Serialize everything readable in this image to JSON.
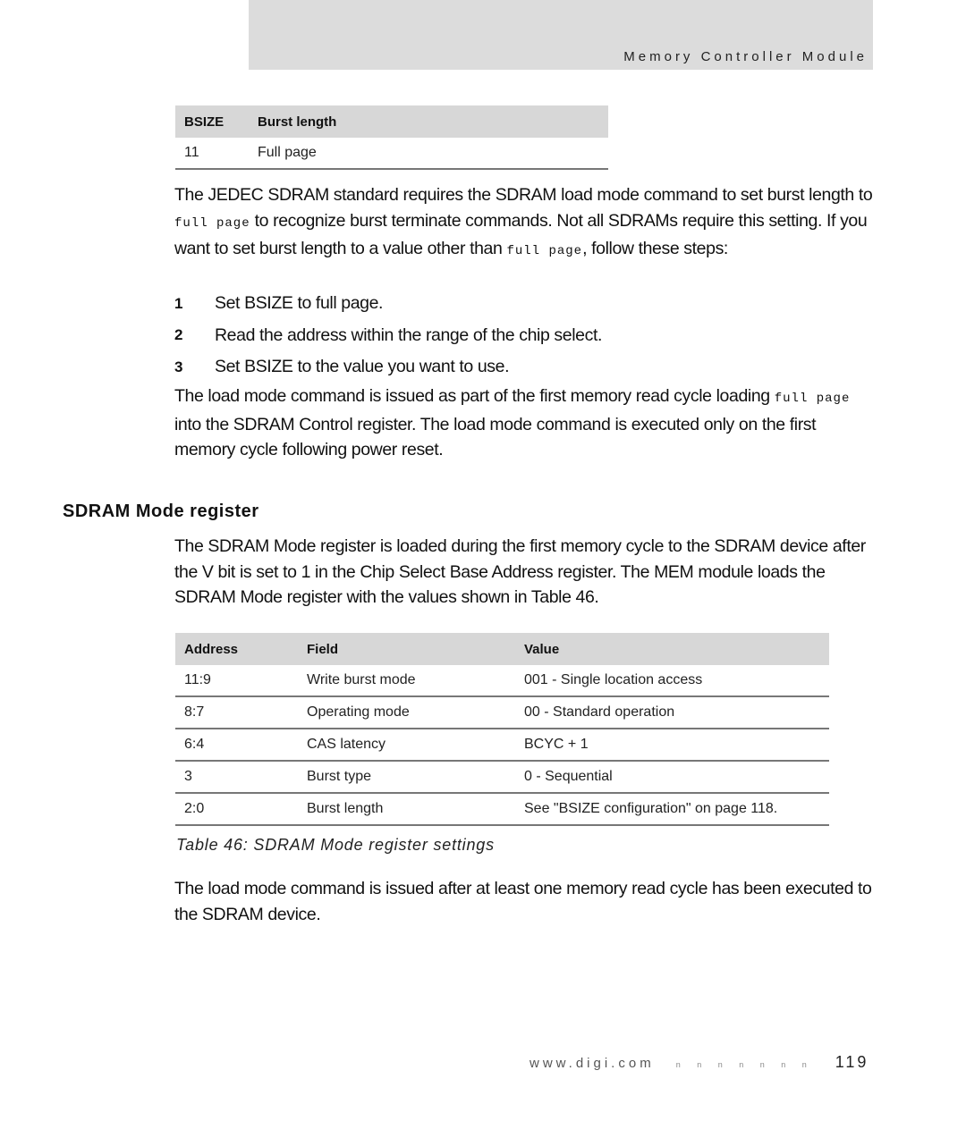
{
  "header": {
    "title": "Memory Controller Module"
  },
  "bsize_table": {
    "columns": [
      "BSIZE",
      "Burst length"
    ],
    "rows": [
      [
        "11",
        "Full page"
      ]
    ]
  },
  "intro_paragraph": {
    "part1": "The JEDEC SDRAM standard requires the SDRAM load mode command to set burst length to ",
    "code1": "full page",
    "part2": " to recognize burst terminate commands. Not all SDRAMs require this setting. If you want to set burst length to a value other than ",
    "code2": "full page",
    "part3": ", follow these steps:"
  },
  "steps": [
    {
      "num": "1",
      "text": "Set BSIZE to full page."
    },
    {
      "num": "2",
      "text": "Read the address within the range of the chip select."
    },
    {
      "num": "3",
      "text": "Set BSIZE to the value you want to use."
    }
  ],
  "load_paragraph": {
    "part1": "The load mode command is issued as part of the first memory read cycle loading ",
    "code1": "full page",
    "part2": " into the SDRAM Control register. The load mode command is executed only on the first memory cycle following power reset."
  },
  "section": {
    "heading": "SDRAM Mode register",
    "paragraph": "The SDRAM Mode register is loaded during the first memory cycle to the SDRAM device after the V bit is set to 1 in the Chip Select Base Address register. The MEM module loads the SDRAM Mode register with the values shown in Table 46."
  },
  "mode_table": {
    "columns": [
      "Address",
      "Field",
      "Value"
    ],
    "rows": [
      [
        "11:9",
        "Write burst mode",
        "001 - Single location access"
      ],
      [
        "8:7",
        "Operating mode",
        "00 - Standard operation"
      ],
      [
        "6:4",
        "CAS latency",
        "BCYC +  1"
      ],
      [
        "3",
        "Burst type",
        "0 - Sequential"
      ],
      [
        "2:0",
        "Burst length",
        "See \"BSIZE configuration\" on page 118."
      ]
    ],
    "caption": "Table 46: SDRAM Mode register settings"
  },
  "closing_paragraph": "The load mode command is issued after at least one memory read cycle has been executed to the SDRAM device.",
  "footer": {
    "url": "www.digi.com",
    "marks": "n n n n n n n",
    "page_number": "119"
  }
}
